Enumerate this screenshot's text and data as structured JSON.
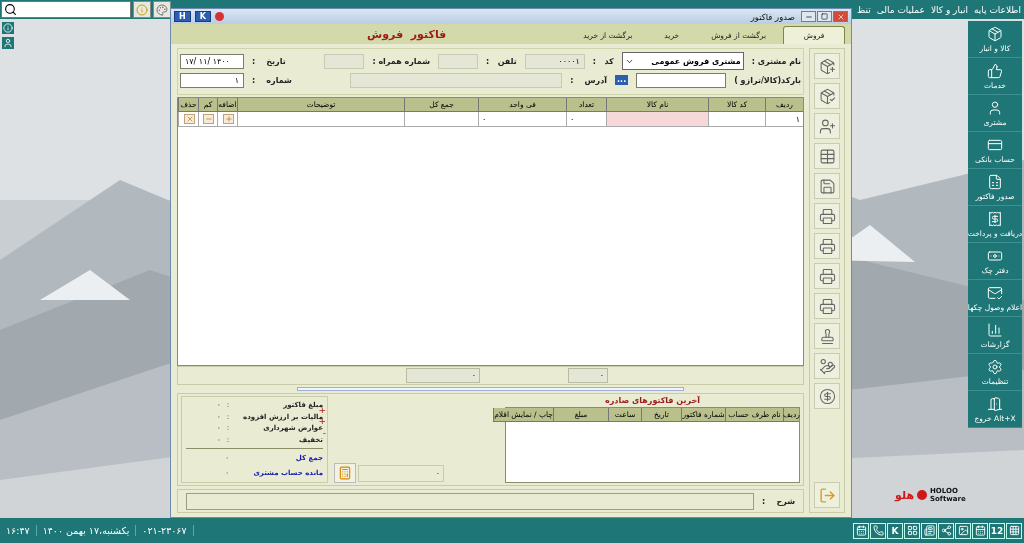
{
  "top_bar": {
    "menus": [
      "اطلاعات پایه",
      "انبار و کالا",
      "عملیات مالی",
      "تنظ"
    ]
  },
  "window": {
    "title": "صدور فاکتور",
    "title_buttons": [
      "K",
      "H"
    ],
    "tabs": [
      {
        "label": "فروش",
        "selected": true
      },
      {
        "label": "برگشت از فروش",
        "selected": false
      },
      {
        "label": "خرید",
        "selected": false
      },
      {
        "label": "برگشت از خرید",
        "selected": false
      }
    ],
    "heading": "فاکتور  فروش",
    "form": {
      "customer_label": "نام مشتری :",
      "customer": "مشتری فروش عمومی",
      "code_label": "کد   :",
      "code": "۰۰۰۰۱",
      "phone_label": "تلفن   :",
      "mobile_label": "شماره همراه :",
      "date_label": "تاریخ    :",
      "date": "۱۷/ ۱۱/ ۱۴۰۰",
      "barcode_label": "بارکد(کالا/ترازو )",
      "browse": "...",
      "address_label": "آدرس    :",
      "number_label": "شماره    :",
      "number": "۱"
    },
    "items_table": {
      "columns": [
        "ردیف",
        "کد کالا",
        "نام کالا",
        "تعداد",
        "فی واحد",
        "جمع کل",
        "توضیحات",
        "اضافه",
        "کم",
        "حذف"
      ],
      "rows": [
        {
          "row": "۱",
          "quantity": "۰",
          "unit_price": "۰"
        }
      ]
    },
    "totals": [
      "۰",
      "۰"
    ],
    "summary": [
      {
        "label": "مبلغ فاکتور",
        "separator": ":",
        "value": "۰"
      },
      {
        "label": "مالیات بر ارزش افزوده",
        "separator": ":",
        "value": "۰",
        "sign": "+"
      },
      {
        "label": "عوارض شهرداری",
        "separator": ":",
        "value": "۰",
        "sign": "+"
      },
      {
        "label": "تخفیف",
        "separator": ":",
        "value": "۰",
        "sign": "-"
      }
    ],
    "summary_totals": [
      {
        "label": "جمع کل",
        "value": "۰"
      },
      {
        "label": "مانده حساب مشتری",
        "value": "۰"
      }
    ],
    "calculator_value": "۰",
    "recent": {
      "title": "آخرین فاکتورهای صادره",
      "columns": [
        "ردیف",
        "نام طرف حساب",
        "شماره فاکتور",
        "تاریخ",
        "ساعت",
        "مبلغ",
        "چاپ / نمایش اقلام"
      ]
    },
    "description_label": "شرح    :"
  },
  "sidebar": [
    "کالا و انبار",
    "خدمات",
    "مشتری",
    "حساب بانکی",
    "صدور فاکتور",
    "دریافت و پرداخت",
    "دفتر چک",
    "اعلام وصول چکها",
    "گزارشات",
    "تنظیمات",
    "خروج Alt+X"
  ],
  "status_bar": {
    "time": "۱۶:۴۷",
    "date": "یکشنبه،۱۷ بهمن ۱۴۰۰",
    "phone": "۰۲۱-۲۳۰۶۷",
    "tray": [
      {
        "kind": "icon"
      },
      {
        "kind": "text",
        "label": "12"
      },
      {
        "kind": "icon"
      },
      {
        "kind": "icon"
      },
      {
        "kind": "icon"
      },
      {
        "kind": "icon"
      },
      {
        "kind": "icon"
      },
      {
        "kind": "text",
        "label": "K"
      },
      {
        "kind": "icon"
      },
      {
        "kind": "icon"
      }
    ]
  },
  "logo": {
    "mark": "هلو",
    "name": "HOLOO",
    "sub": "Software"
  }
}
